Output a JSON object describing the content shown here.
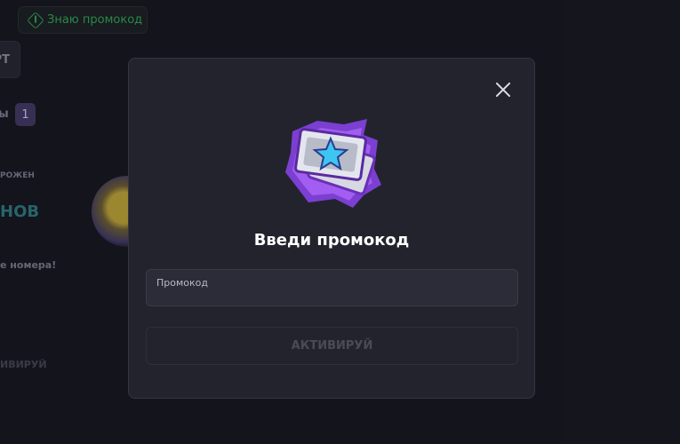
{
  "background": {
    "know_promo_label": "Знаю промокод",
    "start_button_label": "РТ",
    "count_text": "ы",
    "count_badge": "1",
    "frozen_text": "РОЖЕН",
    "big_text": "НОВ",
    "numbers_text": "е номера!",
    "activate_text": "ИВИРУЙ"
  },
  "modal": {
    "title": "Введи промокод",
    "promo_field": {
      "label": "Промокод",
      "value": ""
    },
    "activate_button_label": "АКТИВИРУЙ"
  },
  "colors": {
    "modal_bg": "#23232e",
    "accent_green": "#2f8f4c",
    "accent_purple": "#9b5de5",
    "star_blue": "#3ec6f2"
  }
}
